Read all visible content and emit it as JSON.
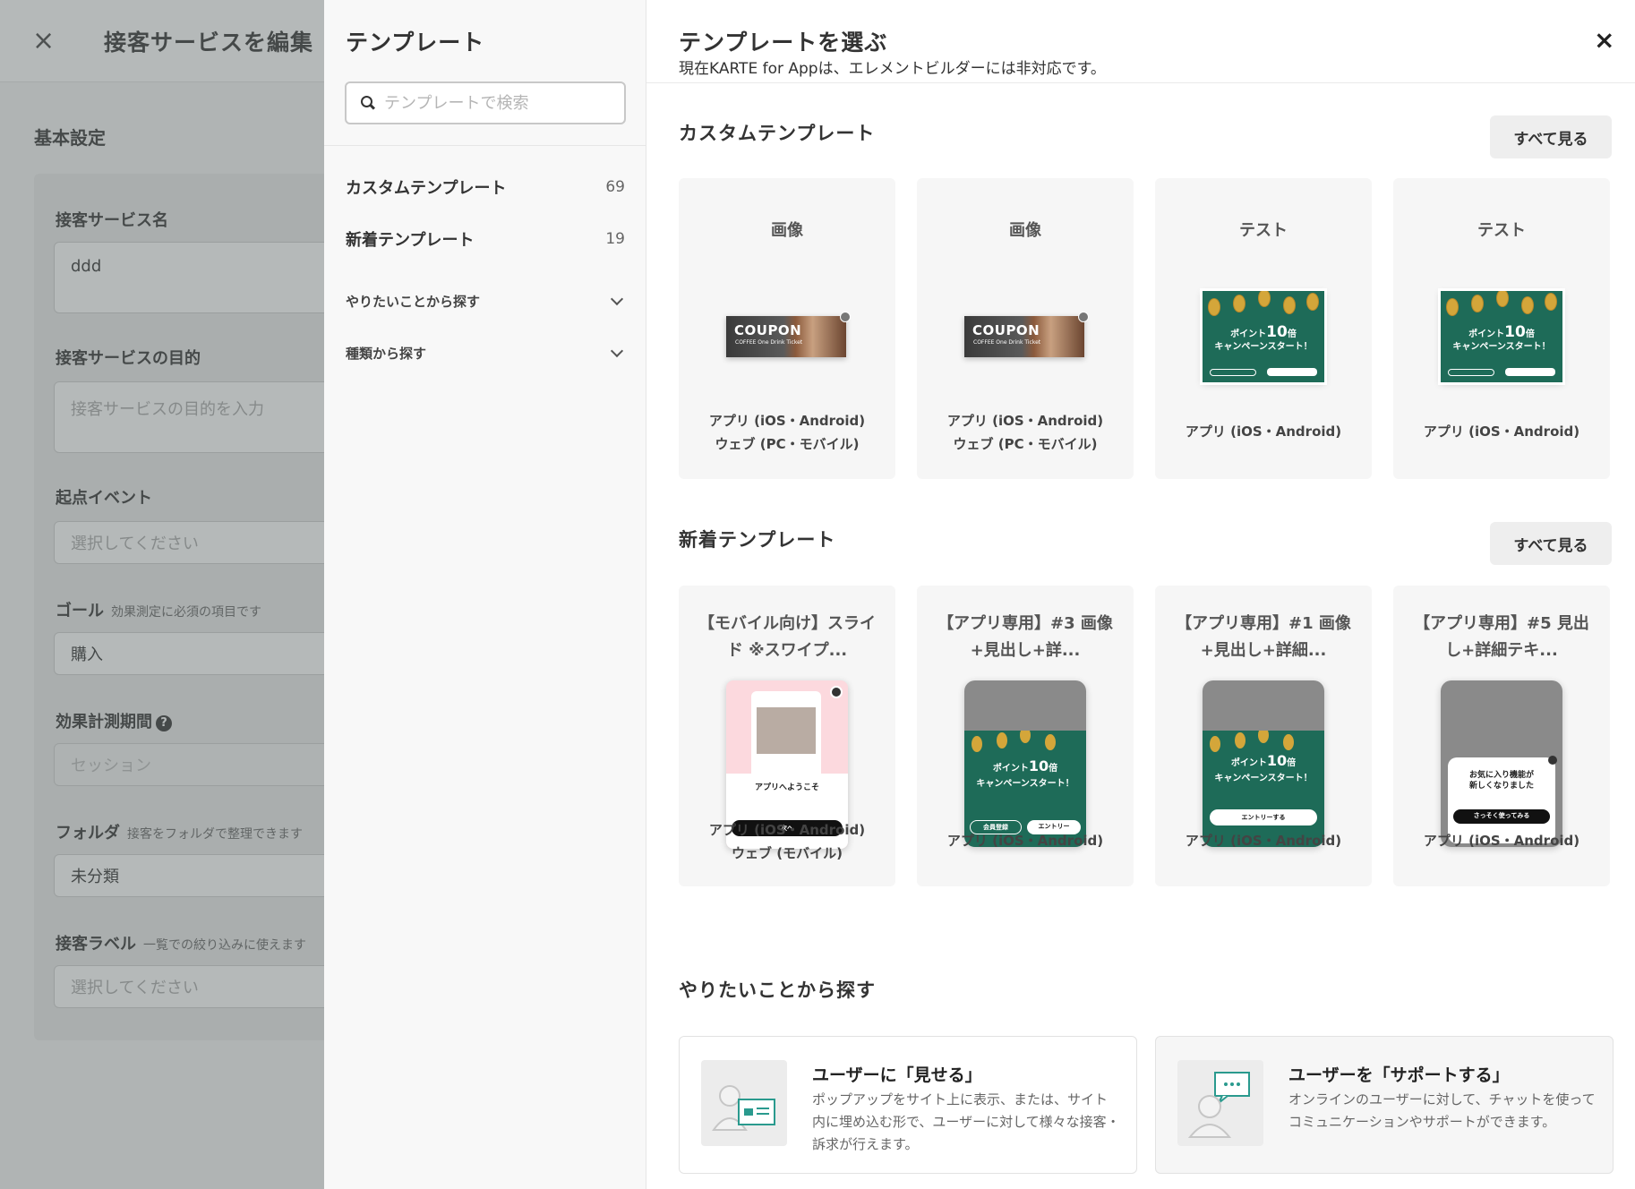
{
  "editor": {
    "close_icon": "×",
    "title": "接客サービスを編集",
    "section_title": "基本設定",
    "fields": {
      "name_label": "接客サービス名",
      "name_value": "ddd",
      "purpose_label": "接客サービスの目的",
      "purpose_placeholder": "接客サービスの目的を入力",
      "start_event_label": "起点イベント",
      "start_event_placeholder": "選択してください",
      "goal_label": "ゴール",
      "goal_note": "効果測定に必須の項目です",
      "goal_value": "購入",
      "period_label": "効果計測期間",
      "period_value": "セッション",
      "folder_label": "フォルダ",
      "folder_note": "接客をフォルダで整理できます",
      "folder_value": "未分類",
      "label_label": "接客ラベル",
      "label_note": "一覧での絞り込みに使えます",
      "label_placeholder": "選択してください"
    }
  },
  "nav": {
    "title": "テンプレート",
    "search_placeholder": "テンプレートで検索",
    "items": [
      {
        "label": "カスタムテンプレート",
        "count": "69"
      },
      {
        "label": "新着テンプレート",
        "count": "19"
      },
      {
        "label": "やりたいことから探す"
      },
      {
        "label": "種類から探す"
      }
    ]
  },
  "main": {
    "title": "テンプレートを選ぶ",
    "subtitle": "現在KARTE for Appは、エレメントビルダーには非対応です。",
    "close_icon": "×",
    "custom": {
      "title": "カスタムテンプレート",
      "see_all": "すべて見る",
      "cards": [
        {
          "name": "画像",
          "platform1": "アプリ (iOS・Android)",
          "platform2": "ウェブ (PC・モバイル)"
        },
        {
          "name": "画像",
          "platform1": "アプリ (iOS・Android)",
          "platform2": "ウェブ (PC・モバイル)"
        },
        {
          "name": "テスト",
          "platform1": "アプリ (iOS・Android)"
        },
        {
          "name": "テスト",
          "platform1": "アプリ (iOS・Android)"
        }
      ]
    },
    "new": {
      "title": "新着テンプレート",
      "see_all": "すべて見る",
      "cards": [
        {
          "name": "【モバイル向け】スライド ※スワイプ...",
          "platform1": "アプリ (iOS・Android)",
          "platform2": "ウェブ (モバイル)"
        },
        {
          "name": "【アプリ専用】#3 画像+見出し+詳...",
          "platform1": "アプリ (iOS・Android)"
        },
        {
          "name": "【アプリ専用】#1 画像+見出し+詳細...",
          "platform1": "アプリ (iOS・Android)"
        },
        {
          "name": "【アプリ専用】#5 見出し+詳細テキ...",
          "platform1": "アプリ (iOS・Android)"
        }
      ]
    },
    "thumb_text": {
      "coupon": "COUPON",
      "coupon_sub": "COFFEE One Drink Ticket",
      "points_prefix": "ポイント",
      "points_big": "10",
      "points_suffix": "倍",
      "campaign": "キャンペーンスタート！",
      "entry": "エントリー",
      "entry_do": "エントリーする",
      "member": "会員登録",
      "welcome": "アプリへようこそ",
      "next": "次へ",
      "fav_line1": "お気に入り機能が",
      "fav_line2": "新しくなりました",
      "try_now": "さっそく使ってみる"
    },
    "ideas": {
      "title": "やりたいことから探す",
      "items": [
        {
          "title": "ユーザーに「見せる」",
          "desc": "ポップアップをサイト上に表示、または、サイト内に埋め込む形で、ユーザーに対して様々な接客・訴求が行えます。"
        },
        {
          "title": "ユーザーを「サポートする」",
          "desc": "オンラインのユーザーに対して、チャットを使ってコミュニケーションやサポートができます。"
        }
      ]
    }
  },
  "colors": {
    "template_green": "#1e6b58",
    "coin_gold": "#d4a63a",
    "card_bg": "#f6f6f6",
    "overlay": "rgba(90,100,100,0.45)"
  }
}
